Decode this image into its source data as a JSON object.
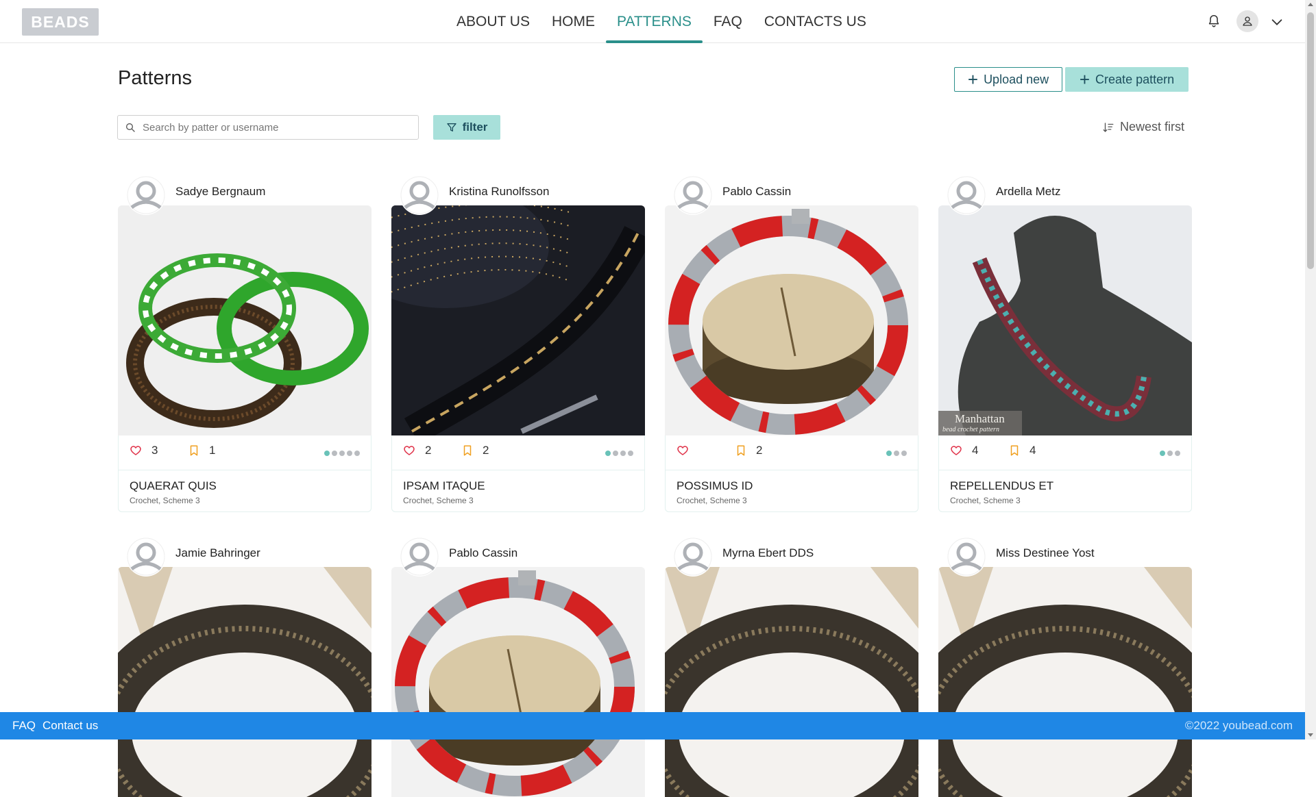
{
  "header": {
    "logo": "BEADS",
    "nav": [
      "ABOUT US",
      "HOME",
      "PATTERNS",
      "FAQ",
      "CONTACTS US"
    ],
    "active_nav": "PATTERNS",
    "icons": [
      "bell-icon",
      "user-icon",
      "chevron-down-icon"
    ]
  },
  "page": {
    "title": "Patterns",
    "upload_label": "Upload new",
    "create_label": "Create pattern",
    "search_placeholder": "Search by patter or username",
    "filter_label": "filter",
    "sort_label": "Newest first"
  },
  "cards": [
    {
      "author": "Sadye Bergnaum",
      "likes": "3",
      "saves": "1",
      "title": "QUAERAT QUIS",
      "sub": "Crochet, Scheme 3",
      "dots_total": 5,
      "dots_on": 1,
      "image": "green-white-brown-bracelets"
    },
    {
      "author": "Kristina Runolfsson",
      "likes": "2",
      "saves": "2",
      "title": "IPSAM ITAQUE",
      "sub": "Crochet, Scheme 3",
      "dots_total": 4,
      "dots_on": 1,
      "image": "black-gold-rope"
    },
    {
      "author": "Pablo Cassin",
      "likes": "",
      "saves": "2",
      "title": "POSSIMUS ID",
      "sub": "Crochet, Scheme 3",
      "dots_total": 3,
      "dots_on": 1,
      "image": "red-grey-necklace-on-wood"
    },
    {
      "author": "Ardella Metz",
      "likes": "4",
      "saves": "4",
      "title": "REPELLENDUS ET",
      "sub": "Crochet, Scheme 3",
      "dots_total": 3,
      "dots_on": 1,
      "image": "multicolor-necklace-on-bust",
      "watermark": "Manhattan",
      "watermark_sub": "bead crochet pattern"
    },
    {
      "author": "Jamie Bahringer",
      "image": "dark-bronze-rope"
    },
    {
      "author": "Pablo Cassin",
      "image": "red-grey-necklace-on-wood"
    },
    {
      "author": "Myrna Ebert DDS",
      "image": "dark-bronze-rope"
    },
    {
      "author": "Miss Destinee Yost",
      "image": "dark-bronze-rope"
    }
  ],
  "footer": {
    "faq": "FAQ",
    "contact": "Contact us",
    "copyright": "©2022 youbead.com"
  },
  "colors": {
    "accent": "#2a8f8a",
    "button_fill": "#a8e0da",
    "footer": "#1f87e5",
    "like": "#e0334a",
    "save": "#f0a020"
  }
}
